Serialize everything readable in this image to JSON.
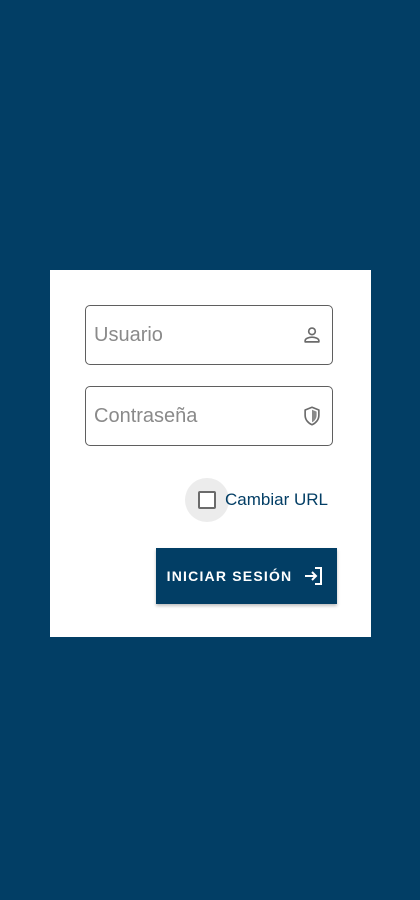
{
  "login": {
    "username_placeholder": "Usuario",
    "password_placeholder": "Contraseña",
    "change_url_label": "Cambiar URL",
    "change_url_checked": false,
    "submit_label": "INICIAR SESIÓN"
  },
  "icons": {
    "username": "person-icon",
    "password": "shield-icon",
    "submit": "login-arrow-icon"
  },
  "colors": {
    "background": "#023e65",
    "card": "#ffffff",
    "button": "#023e65",
    "button_text": "#ffffff",
    "checkbox_label": "#033e65"
  }
}
